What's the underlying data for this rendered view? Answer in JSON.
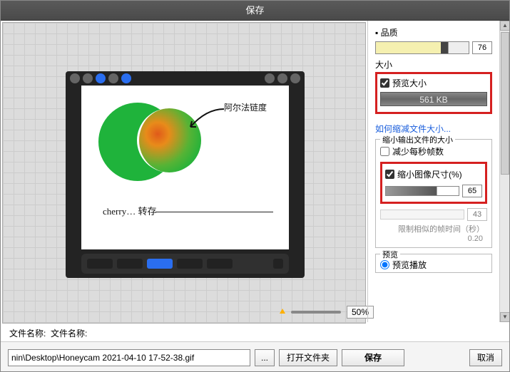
{
  "title": "保存",
  "preview": {
    "annotation1": "阿尔法链度",
    "annotation2": "cherry… 转存",
    "zoom_value": "50%"
  },
  "side": {
    "quality_label": "品质",
    "quality_value": "76",
    "size_label": "大小",
    "preview_size_chk": "预览大小",
    "size_value": "561 KB",
    "shrink_link": "如何缩减文件大小...",
    "group_title": "缩小输出文件的大小",
    "reduce_fps_label": "减少每秒帧数",
    "reduce_dim_label": "缩小图像尺寸(%)",
    "reduce_dim_value": "65",
    "extra_value": "43",
    "limit_hint": "限制相似的帧时间（秒）",
    "limit_value": "0.20",
    "preview_group": "预览",
    "preview_radio": "预览播放"
  },
  "bottom": {
    "file_label1": "文件名称:",
    "file_label2": "文件名称:",
    "file_value": "nin\\Desktop\\Honeycam 2021-04-10 17-52-38.gif",
    "browse": "...",
    "open_folder": "打开文件夹",
    "save": "保存",
    "cancel": "取消"
  }
}
